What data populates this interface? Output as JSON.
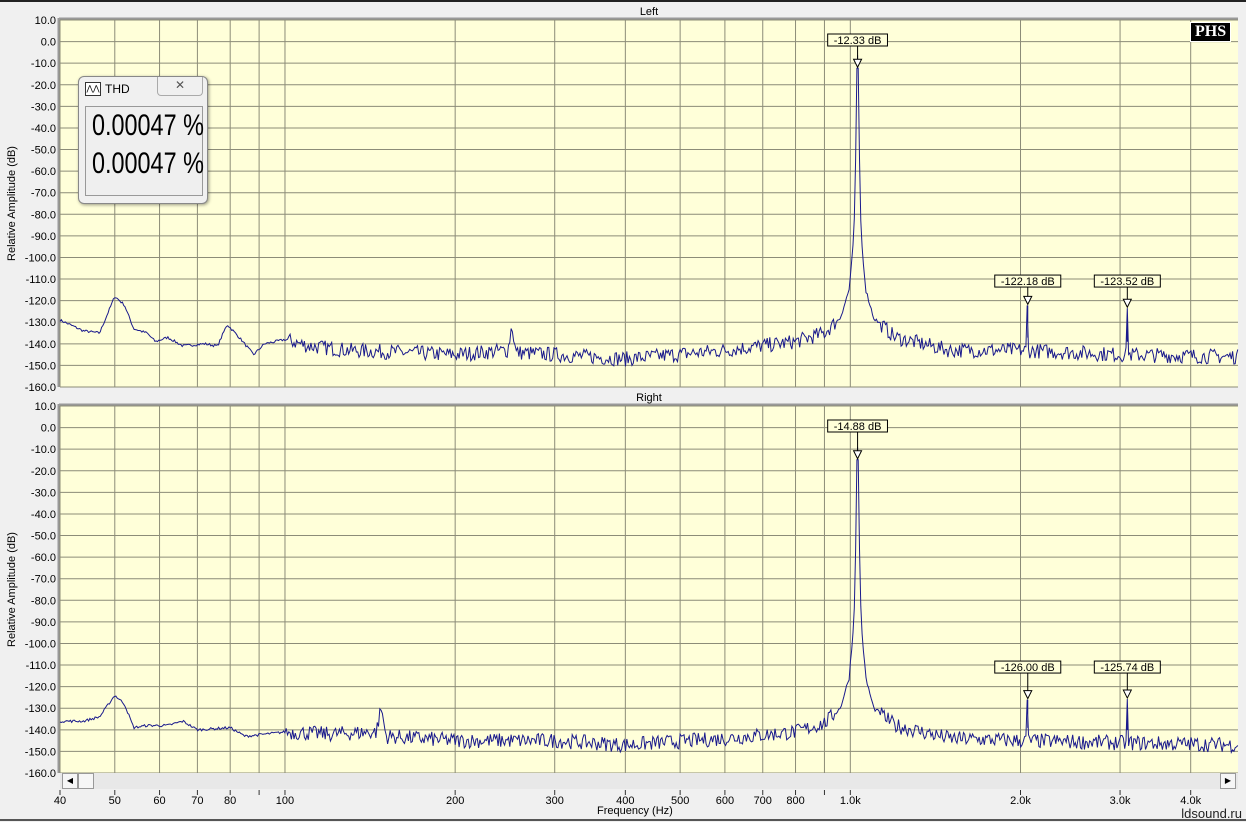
{
  "chart_data": [
    {
      "type": "line",
      "title": "Left",
      "xlabel": "Frequency (Hz)",
      "ylabel": "Relative Amplitude (dB)",
      "xscale": "log",
      "xlim": [
        40,
        4850
      ],
      "ylim": [
        -160,
        10
      ],
      "grid": true,
      "yticks": [
        "10.0",
        "0.0",
        "-10.0",
        "-20.0",
        "-30.0",
        "-40.0",
        "-50.0",
        "-60.0",
        "-70.0",
        "-80.0",
        "-90.0",
        "-100.0",
        "-110.0",
        "-120.0",
        "-130.0",
        "-140.0",
        "-150.0",
        "-160.0"
      ],
      "series": [
        {
          "name": "Left",
          "color": "#1a1a8c",
          "points": [
            [
              40,
              -129
            ],
            [
              44,
              -134
            ],
            [
              47,
              -135
            ],
            [
              50,
              -118
            ],
            [
              52,
              -122
            ],
            [
              54,
              -133
            ],
            [
              57,
              -135
            ],
            [
              59,
              -139
            ],
            [
              62,
              -137
            ],
            [
              66,
              -141
            ],
            [
              72,
              -140
            ],
            [
              76,
              -141
            ],
            [
              79,
              -131
            ],
            [
              83,
              -137
            ],
            [
              88,
              -145
            ],
            [
              92,
              -140
            ],
            [
              100,
              -138
            ],
            [
              110,
              -141
            ],
            [
              130,
              -143
            ],
            [
              200,
              -145
            ],
            [
              248,
              -143
            ],
            [
              252,
              -131
            ],
            [
              256,
              -144
            ],
            [
              300,
              -145
            ],
            [
              400,
              -147
            ],
            [
              600,
              -143
            ],
            [
              800,
              -139
            ],
            [
              900,
              -135
            ],
            [
              960,
              -128
            ],
            [
              995,
              -115
            ],
            [
              1015,
              -90
            ],
            [
              1030,
              -12.33
            ],
            [
              1045,
              -90
            ],
            [
              1065,
              -115
            ],
            [
              1100,
              -128
            ],
            [
              1200,
              -137
            ],
            [
              1500,
              -143
            ],
            [
              2000,
              -143
            ],
            [
              3000,
              -145
            ],
            [
              4850,
              -146
            ]
          ]
        }
      ],
      "markers": [
        {
          "freq": 1030,
          "label": "-12.33 dB",
          "value": -12.33
        },
        {
          "freq": 2060,
          "label": "-122.18 dB",
          "value": -122.18
        },
        {
          "freq": 3090,
          "label": "-123.52 dB",
          "value": -123.52
        }
      ]
    },
    {
      "type": "line",
      "title": "Right",
      "xlabel": "Frequency (Hz)",
      "ylabel": "Relative Amplitude (dB)",
      "xscale": "log",
      "xlim": [
        40,
        4850
      ],
      "ylim": [
        -160,
        10
      ],
      "grid": true,
      "yticks": [
        "10.0",
        "0.0",
        "-10.0",
        "-20.0",
        "-30.0",
        "-40.0",
        "-50.0",
        "-60.0",
        "-70.0",
        "-80.0",
        "-90.0",
        "-100.0",
        "-110.0",
        "-120.0",
        "-130.0",
        "-140.0",
        "-150.0",
        "-160.0"
      ],
      "series": [
        {
          "name": "Right",
          "color": "#1a1a8c",
          "points": [
            [
              40,
              -136
            ],
            [
              44,
              -136
            ],
            [
              47,
              -134
            ],
            [
              50,
              -124
            ],
            [
              52,
              -128
            ],
            [
              54,
              -139
            ],
            [
              57,
              -138
            ],
            [
              62,
              -138
            ],
            [
              66,
              -136
            ],
            [
              70,
              -140
            ],
            [
              80,
              -139
            ],
            [
              85,
              -143
            ],
            [
              100,
              -141
            ],
            [
              120,
              -142
            ],
            [
              145,
              -141
            ],
            [
              148,
              -130
            ],
            [
              151,
              -143
            ],
            [
              200,
              -145
            ],
            [
              300,
              -145
            ],
            [
              400,
              -147
            ],
            [
              600,
              -144
            ],
            [
              800,
              -141
            ],
            [
              900,
              -137
            ],
            [
              960,
              -130
            ],
            [
              995,
              -116
            ],
            [
              1015,
              -90
            ],
            [
              1030,
              -14.88
            ],
            [
              1045,
              -90
            ],
            [
              1065,
              -116
            ],
            [
              1100,
              -130
            ],
            [
              1200,
              -138
            ],
            [
              1500,
              -144
            ],
            [
              2000,
              -145
            ],
            [
              3000,
              -146
            ],
            [
              4850,
              -147
            ]
          ]
        }
      ],
      "markers": [
        {
          "freq": 1030,
          "label": "-14.88 dB",
          "value": -14.88
        },
        {
          "freq": 2060,
          "label": "-126.00 dB",
          "value": -126.0
        },
        {
          "freq": 3090,
          "label": "-125.74 dB",
          "value": -125.74
        }
      ]
    }
  ],
  "x_axis": {
    "label": "Frequency (Hz)",
    "ticks": [
      {
        "f": 40,
        "t": "40"
      },
      {
        "f": 50,
        "t": "50"
      },
      {
        "f": 60,
        "t": "60"
      },
      {
        "f": 70,
        "t": "70"
      },
      {
        "f": 80,
        "t": "80"
      },
      {
        "f": 90,
        "t": ""
      },
      {
        "f": 100,
        "t": "100"
      },
      {
        "f": 200,
        "t": "200"
      },
      {
        "f": 300,
        "t": "300"
      },
      {
        "f": 400,
        "t": "400"
      },
      {
        "f": 500,
        "t": "500"
      },
      {
        "f": 600,
        "t": "600"
      },
      {
        "f": 700,
        "t": "700"
      },
      {
        "f": 800,
        "t": "800"
      },
      {
        "f": 900,
        "t": ""
      },
      {
        "f": 1000,
        "t": "1.0k"
      },
      {
        "f": 2000,
        "t": "2.0k"
      },
      {
        "f": 3000,
        "t": "3.0k"
      },
      {
        "f": 4000,
        "t": "4.0k"
      }
    ]
  },
  "thd": {
    "title": "THD",
    "close": "✕",
    "left": "0.00047 %",
    "right": "0.00047 %"
  },
  "logo": "PHS",
  "watermark": "ldsound.ru",
  "scroll": {
    "left": "◀",
    "right": "▶"
  }
}
